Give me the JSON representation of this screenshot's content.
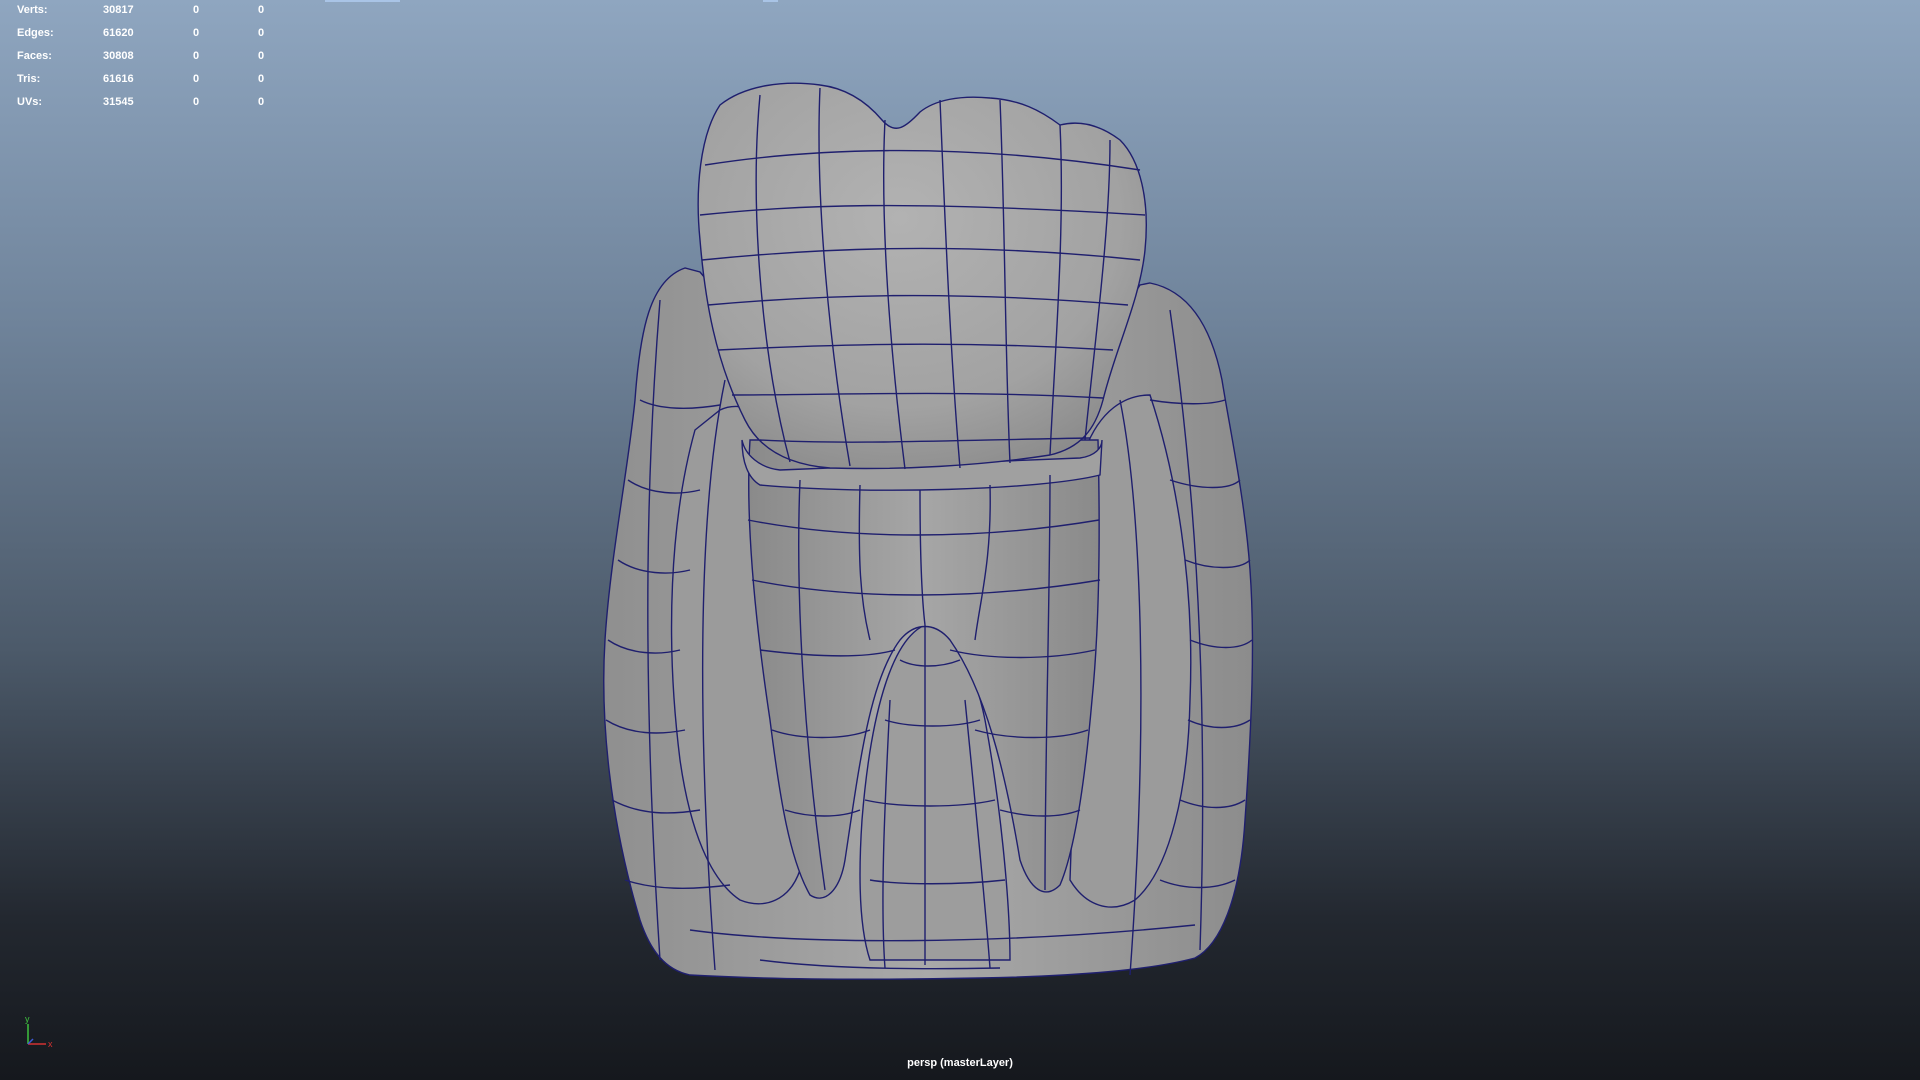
{
  "hud": {
    "rows": [
      {
        "label": "Verts:",
        "total": "30817",
        "sel1": "0",
        "sel2": "0"
      },
      {
        "label": "Edges:",
        "total": "61620",
        "sel1": "0",
        "sel2": "0"
      },
      {
        "label": "Faces:",
        "total": "30808",
        "sel1": "0",
        "sel2": "0"
      },
      {
        "label": "Tris:",
        "total": "61616",
        "sel1": "0",
        "sel2": "0"
      },
      {
        "label": "UVs:",
        "total": "31545",
        "sel1": "0",
        "sel2": "0"
      }
    ]
  },
  "viewport": {
    "camera_label": "persp (masterLayer)",
    "colors": {
      "wireframe": "#1f1f6e",
      "model_fill": "#a6a6a6",
      "gizmo_x": "#d23232",
      "gizmo_y": "#3ec23e",
      "gizmo_z": "#3c5ad8"
    },
    "axis_labels": {
      "x": "x",
      "y": "y"
    }
  }
}
